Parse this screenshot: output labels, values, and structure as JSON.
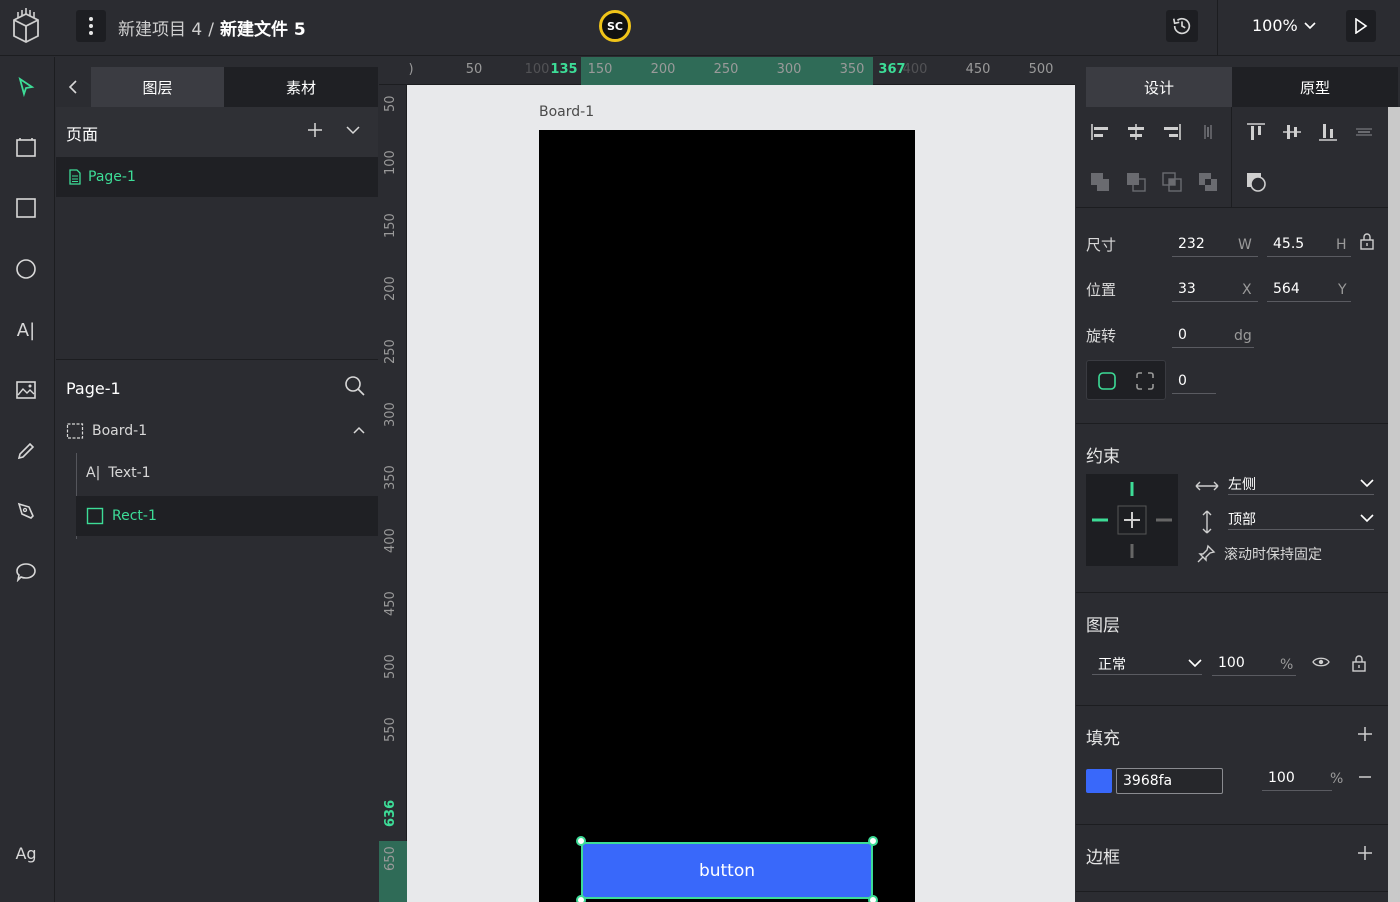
{
  "topbar": {
    "breadcrumb_project": "新建项目 4",
    "breadcrumb_sep": "/",
    "breadcrumb_file": "新建文件 5",
    "avatar_initials": "SC",
    "avatar_ring_color": "#f0c419",
    "zoom_label": "100%"
  },
  "left_panel": {
    "tabs": [
      "图层",
      "素材"
    ],
    "pages_title": "页面",
    "pages": [
      {
        "label": "Page-1"
      }
    ],
    "layers_title": "Page-1",
    "layers": [
      {
        "label": "Board-1",
        "type": "board"
      },
      {
        "label": "Text-1",
        "type": "text"
      },
      {
        "label": "Rect-1",
        "type": "rect",
        "selected": true
      }
    ]
  },
  "toolbar": {
    "text_tool_label": "A|",
    "font_tool_label": "Ag"
  },
  "rulers": {
    "top_labels": [
      {
        "text": ")",
        "hl": false
      },
      {
        "text": "50",
        "hl": false
      },
      {
        "text": "100",
        "hl": false
      },
      {
        "text": "135",
        "hl": true
      },
      {
        "text": "150",
        "hl": false
      },
      {
        "text": "200",
        "hl": false
      },
      {
        "text": "250",
        "hl": false
      },
      {
        "text": "300",
        "hl": false
      },
      {
        "text": "350",
        "hl": false
      },
      {
        "text": "367",
        "hl": true
      },
      {
        "text": "400",
        "hl": false
      },
      {
        "text": "450",
        "hl": false
      },
      {
        "text": "500",
        "hl": false
      }
    ],
    "left_labels": [
      {
        "text": "50",
        "hl": false
      },
      {
        "text": "100",
        "hl": false
      },
      {
        "text": "150",
        "hl": false
      },
      {
        "text": "200",
        "hl": false
      },
      {
        "text": "250",
        "hl": false
      },
      {
        "text": "300",
        "hl": false
      },
      {
        "text": "350",
        "hl": false
      },
      {
        "text": "400",
        "hl": false
      },
      {
        "text": "450",
        "hl": false
      },
      {
        "text": "500",
        "hl": false
      },
      {
        "text": "550",
        "hl": false
      },
      {
        "text": "636",
        "hl": true
      },
      {
        "text": "650",
        "hl": false
      }
    ]
  },
  "canvas": {
    "board_label": "Board-1",
    "button_label": "button",
    "button_color": "#3968fa",
    "selection_color": "#3ddc97"
  },
  "right_panel": {
    "tabs": [
      "设计",
      "原型"
    ],
    "size_label": "尺寸",
    "width": "232",
    "width_unit": "W",
    "height": "45.5",
    "height_unit": "H",
    "position_label": "位置",
    "x": "33",
    "x_unit": "X",
    "y": "564",
    "y_unit": "Y",
    "rotation_label": "旋转",
    "rotation": "0",
    "rotation_unit": "dg",
    "radius": "0",
    "constraints_title": "约束",
    "constraint_h": "左侧",
    "constraint_v": "顶部",
    "fix_on_scroll": "滚动时保持固定",
    "layer_title": "图层",
    "blend_mode": "正常",
    "layer_opacity": "100",
    "layer_opacity_unit": "%",
    "fill_title": "填充",
    "fill_hex": "3968fa",
    "fill_opacity": "100",
    "fill_opacity_unit": "%",
    "border_title": "边框"
  }
}
